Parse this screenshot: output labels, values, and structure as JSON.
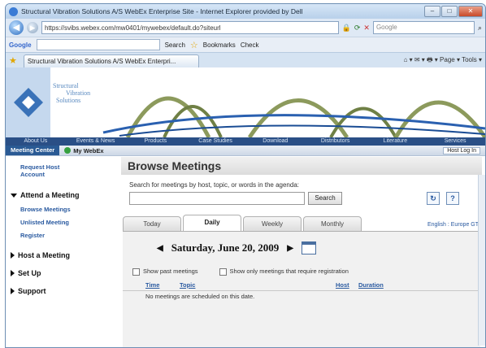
{
  "window": {
    "title": "Structural Vibration Solutions A/S WebEx Enterprise Site - Internet Explorer provided by Dell"
  },
  "addressbar": {
    "url": "https://svibs.webex.com/mw0401/mywebex/default.do?siteurl",
    "search_placeholder": "Google"
  },
  "googlebar": {
    "logo": "Google",
    "search_label": "Search",
    "bookmarks_label": "Bookmarks",
    "check_label": "Check"
  },
  "tabbar": {
    "tab_title": "Structural Vibration Solutions A/S WebEx Enterpri...",
    "page_tools": "Page",
    "tools": "Tools"
  },
  "site": {
    "logo_line1": "Structural",
    "logo_line2": "Vibration",
    "logo_line3": "Solutions",
    "nav": [
      "About Us",
      "Events & News",
      "Products",
      "Case Studies",
      "Download",
      "Distributors",
      "Literature",
      "Services"
    ],
    "meeting_center": "Meeting Center",
    "my_webex": "My WebEx",
    "login": "Host Log In"
  },
  "sidebar": {
    "request_account": "Request Host Account",
    "attend": "Attend a Meeting",
    "browse": "Browse Meetings",
    "unlisted": "Unlisted Meeting",
    "register": "Register",
    "host": "Host a Meeting",
    "setup": "Set Up",
    "support": "Support"
  },
  "main": {
    "title": "Browse Meetings",
    "search_text": "Search for meetings by host, topic, or words in the agenda:",
    "search_button": "Search",
    "tabs": [
      "Today",
      "Daily",
      "Weekly",
      "Monthly"
    ],
    "active_tab": "Daily",
    "lang": "English : Europe GT",
    "date": "Saturday, June 20, 2009",
    "show_past": "Show past meetings",
    "show_reg": "Show only meetings that require registration",
    "col_time": "Time",
    "col_topic": "Topic",
    "col_host": "Host",
    "col_duration": "Duration",
    "no_meetings": "No meetings are scheduled on this date."
  }
}
